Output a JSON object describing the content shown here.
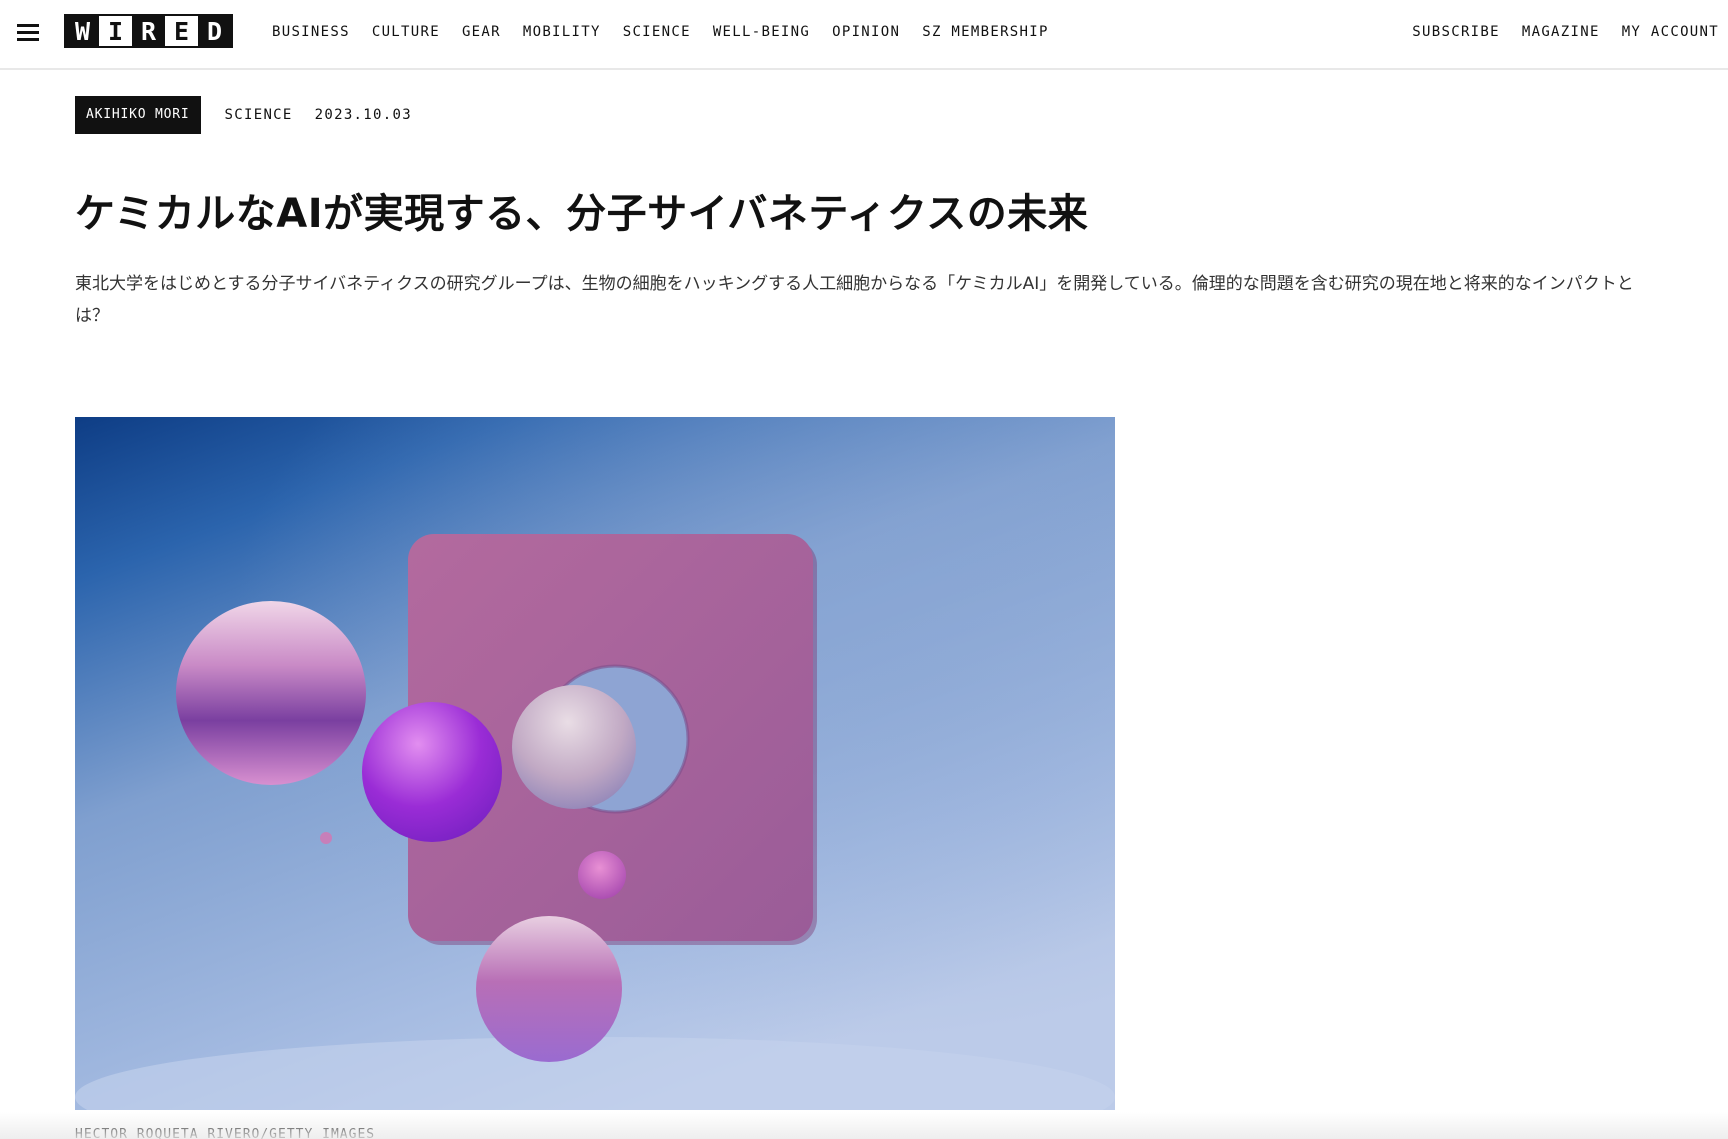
{
  "header": {
    "logo_letters": [
      "W",
      "I",
      "R",
      "E",
      "D"
    ],
    "nav_main": [
      "BUSINESS",
      "CULTURE",
      "GEAR",
      "MOBILITY",
      "SCIENCE",
      "WELL-BEING",
      "OPINION",
      "SZ MEMBERSHIP"
    ],
    "nav_right": [
      "SUBSCRIBE",
      "MAGAZINE",
      "MY ACCOUNT"
    ]
  },
  "article": {
    "author": "AKIHIKO MORI",
    "category": "SCIENCE",
    "date": "2023.10.03",
    "headline": "ケミカルなAIが実現する、分子サイバネティクスの未来",
    "lede": "東北大学をはじめとする分子サイバネティクスの研究グループは、生物の細胞をハッキングする人工細胞からなる「ケミカルAI」を開発している。倫理的な問題を含む研究の現在地と将来的なインパクトとは？",
    "image_credit": "HECTOR ROQUETA RIVERO/GETTY IMAGES"
  },
  "colors": {
    "text": "#111111",
    "tag_background": "#111111",
    "image_sky_top": "#1f5aa3",
    "image_sky_bottom": "#b8c9e8",
    "image_panel": "#a8639a"
  },
  "icons": {
    "menu": "hamburger-menu-icon"
  }
}
